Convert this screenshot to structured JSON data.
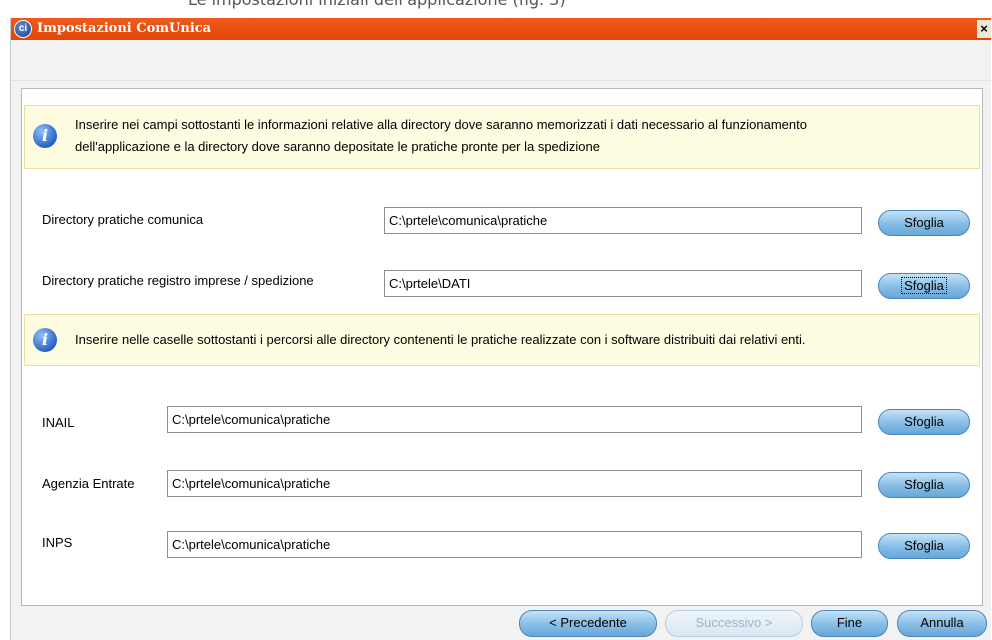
{
  "background_text": "Le impostazioni iniziali dell'applicazione (fig. 3)",
  "window": {
    "title": "Impostazioni ComUnica",
    "icon": "ci-app-icon",
    "close_label": "×"
  },
  "info1": {
    "icon": "info-icon",
    "line1": "Inserire nei campi sottostanti le informazioni relative alla directory dove saranno memorizzati i dati necessario al funzionamento",
    "line2": "dell'applicazione e la directory dove saranno depositate le pratiche pronte per la spedizione"
  },
  "fields": [
    {
      "label": "Directory pratiche comunica",
      "value": "C:\\prtele\\comunica\\pratiche",
      "button": "Sfoglia"
    },
    {
      "label": "Directory pratiche registro imprese / spedizione",
      "value": "C:\\prtele\\DATI",
      "button": "Sfoglia"
    }
  ],
  "info2": {
    "icon": "info-icon",
    "text": "Inserire nelle caselle sottostanti i percorsi alle directory contenenti le pratiche realizzate con i software distribuiti dai relativi enti."
  },
  "entities": [
    {
      "label": "INAIL",
      "value": "C:\\prtele\\comunica\\pratiche",
      "button": "Sfoglia"
    },
    {
      "label": "Agenzia Entrate",
      "value": "C:\\prtele\\comunica\\pratiche",
      "button": "Sfoglia"
    },
    {
      "label": "INPS",
      "value": "C:\\prtele\\comunica\\pratiche",
      "button": "Sfoglia"
    }
  ],
  "footer": {
    "prev": "< Precedente",
    "next": "Successivo >",
    "finish": "Fine",
    "cancel": "Annulla"
  },
  "colors": {
    "titlebar": "#e2460a",
    "info_background": "#fdfbe0",
    "button": "#8ac0e8"
  }
}
